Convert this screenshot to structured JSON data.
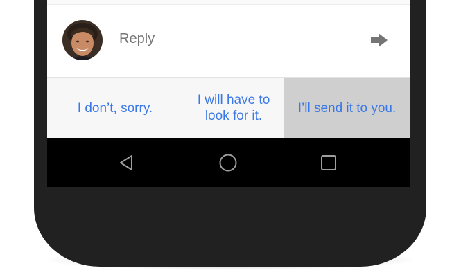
{
  "reply": {
    "label": "Reply",
    "avatar_icon": "user-avatar-photo",
    "send_icon": "arrow-right-icon"
  },
  "suggestions": [
    {
      "text": "I don’t, sorry.",
      "selected": false
    },
    {
      "text": "I will have to look for it.",
      "selected": false
    },
    {
      "text": "I’ll send it to you.",
      "selected": true
    }
  ],
  "navbar": {
    "icons": [
      "back-icon",
      "home-icon",
      "recents-icon"
    ]
  },
  "colors": {
    "suggestion_text": "#3b78e7",
    "selected_bg": "#cfcfcf",
    "phone_body": "#212121"
  }
}
